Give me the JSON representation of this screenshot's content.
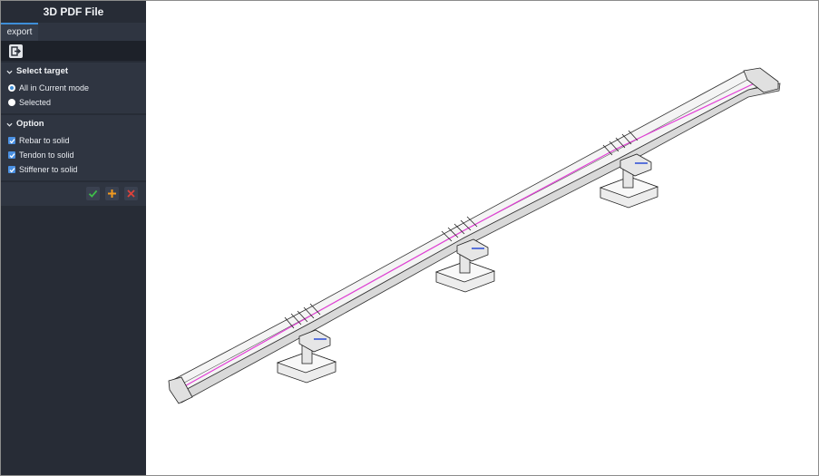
{
  "panel": {
    "title": "3D PDF File",
    "tabs": [
      {
        "label": "export"
      }
    ],
    "toolbar": {
      "export_icon": "export-icon"
    }
  },
  "select_target": {
    "header": "Select target",
    "options": [
      {
        "label": "All in Current mode",
        "selected": true
      },
      {
        "label": "Selected",
        "selected": false
      }
    ]
  },
  "option": {
    "header": "Option",
    "items": [
      {
        "label": "Rebar to solid",
        "checked": true
      },
      {
        "label": "Tendon to solid",
        "checked": true
      },
      {
        "label": "Stiffener to solid",
        "checked": true
      }
    ]
  },
  "actions": {
    "ok_icon": "check-icon",
    "add_icon": "plus-icon",
    "cancel_icon": "close-icon"
  },
  "colors": {
    "sidebar_bg": "#272c36",
    "section_bg": "#2f3541",
    "accent": "#3e8ed8",
    "ok": "#3fbf4a",
    "add": "#f29a1f",
    "cancel": "#e0413a",
    "tendon": "#e23fd6"
  },
  "viewport": {
    "model": "3D bridge model"
  }
}
